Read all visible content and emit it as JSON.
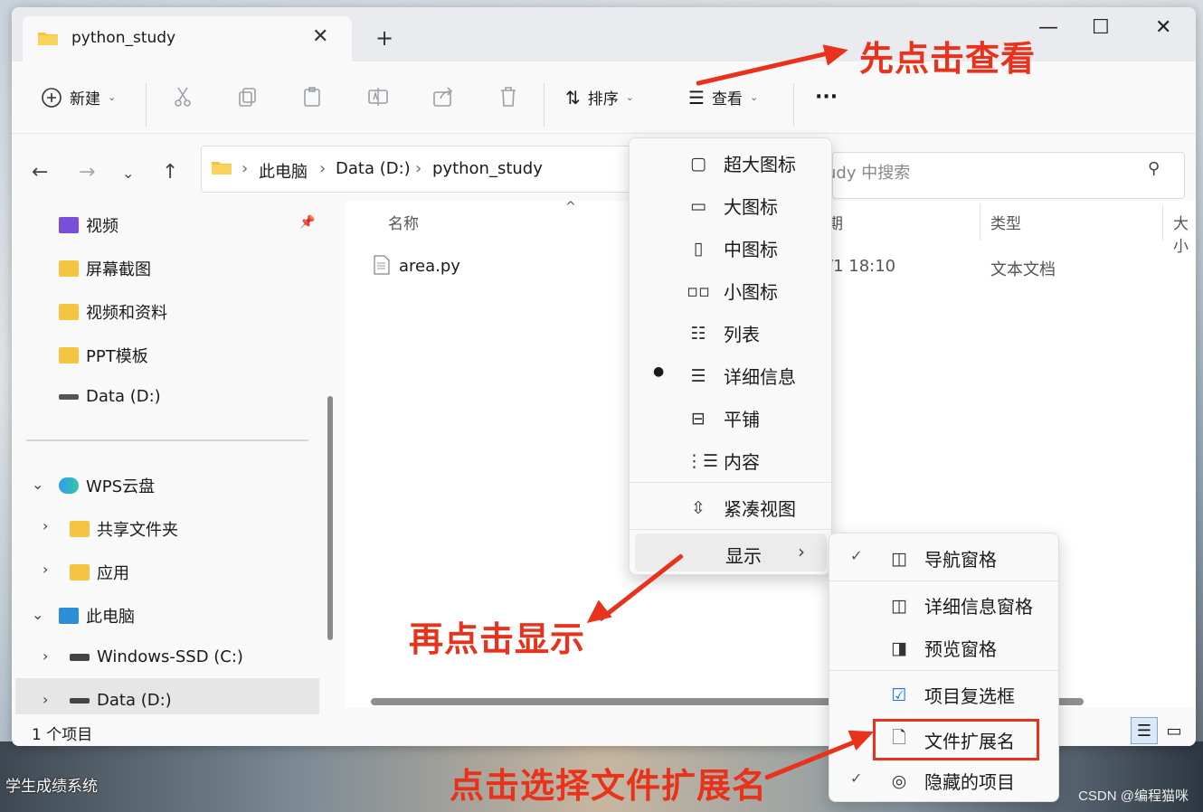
{
  "window": {
    "tab_title": "python_study",
    "tab_close": "✕",
    "new_tab": "+",
    "minimize": "—",
    "maximize": "☐",
    "close": "✕"
  },
  "toolbar": {
    "new_label": "新建",
    "sort_label": "排序",
    "view_label": "查看",
    "more_label": "···"
  },
  "nav": {
    "breadcrumb": [
      "此电脑",
      "Data (D:)",
      "python_study"
    ],
    "search_placeholder": "udy 中搜索"
  },
  "sidebar": {
    "quick": [
      {
        "label": "视频",
        "icon": "video-folder-icon"
      },
      {
        "label": "屏幕截图",
        "icon": "folder-icon"
      },
      {
        "label": "视频和资料",
        "icon": "folder-icon"
      },
      {
        "label": "PPT模板",
        "icon": "folder-icon"
      },
      {
        "label": "Data (D:)",
        "icon": "drive-icon"
      }
    ],
    "wps_cloud": "WPS云盘",
    "shared_folder": "共享文件夹",
    "apps": "应用",
    "this_pc": "此电脑",
    "windows_ssd": "Windows-SSD (C:)",
    "data_drive": "Data (D:)"
  },
  "table": {
    "headers": [
      "名称",
      "期",
      "类型",
      "大小"
    ],
    "rows": [
      {
        "name": "area.py",
        "date": "/1 18:10",
        "type": "文本文档"
      }
    ]
  },
  "status": {
    "count": "1 个项目"
  },
  "view_menu": {
    "items": [
      "超大图标",
      "大图标",
      "中图标",
      "小图标",
      "列表",
      "详细信息",
      "平铺",
      "内容"
    ],
    "selected": "详细信息",
    "compact": "紧凑视图",
    "show": "显示"
  },
  "show_menu": {
    "items": [
      {
        "label": "导航窗格",
        "checked": true
      },
      {
        "label": "详细信息窗格",
        "checked": false
      },
      {
        "label": "预览窗格",
        "checked": false
      },
      {
        "label": "项目复选框",
        "checked": false
      },
      {
        "label": "文件扩展名",
        "checked": false
      },
      {
        "label": "隐藏的项目",
        "checked": true
      }
    ]
  },
  "annotations": {
    "first": "先点击查看",
    "second": "再点击显示",
    "third": "点击选择文件扩展名",
    "color": "#e8321c"
  },
  "desktop": {
    "taskbar_label": "学生成绩系统",
    "watermark": "CSDN @编程猫咪"
  }
}
